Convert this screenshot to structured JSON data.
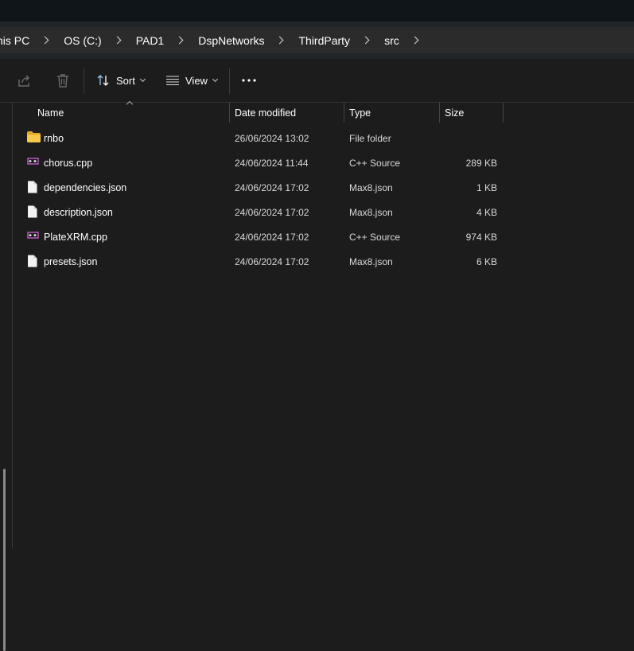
{
  "breadcrumb": {
    "items": [
      "his PC",
      "OS (C:)",
      "PAD1",
      "DspNetworks",
      "ThirdParty",
      "src"
    ]
  },
  "toolbar": {
    "share_icon": "share-icon",
    "delete_icon": "trash-icon",
    "sort_label": "Sort",
    "view_label": "View",
    "more_icon": "more-icon"
  },
  "columns": {
    "name": "Name",
    "date": "Date modified",
    "type": "Type",
    "size": "Size"
  },
  "files": [
    {
      "name": "rnbo",
      "date": "26/06/2024 13:02",
      "type": "File folder",
      "size": "",
      "icon": "folder-icon"
    },
    {
      "name": "chorus.cpp",
      "date": "24/06/2024 11:44",
      "type": "C++ Source",
      "size": "289 KB",
      "icon": "cpp-file-icon"
    },
    {
      "name": "dependencies.json",
      "date": "24/06/2024 17:02",
      "type": "Max8.json",
      "size": "1 KB",
      "icon": "file-icon"
    },
    {
      "name": "description.json",
      "date": "24/06/2024 17:02",
      "type": "Max8.json",
      "size": "4 KB",
      "icon": "file-icon"
    },
    {
      "name": "PlateXRM.cpp",
      "date": "24/06/2024 17:02",
      "type": "C++ Source",
      "size": "974 KB",
      "icon": "cpp-file-icon"
    },
    {
      "name": "presets.json",
      "date": "24/06/2024 17:02",
      "type": "Max8.json",
      "size": "6 KB",
      "icon": "file-icon"
    }
  ],
  "colors": {
    "folder": "#f3c53a",
    "cpp_icon": "#c45bc9",
    "background": "#1c1c1c",
    "address_bg": "#2b2b2b"
  }
}
